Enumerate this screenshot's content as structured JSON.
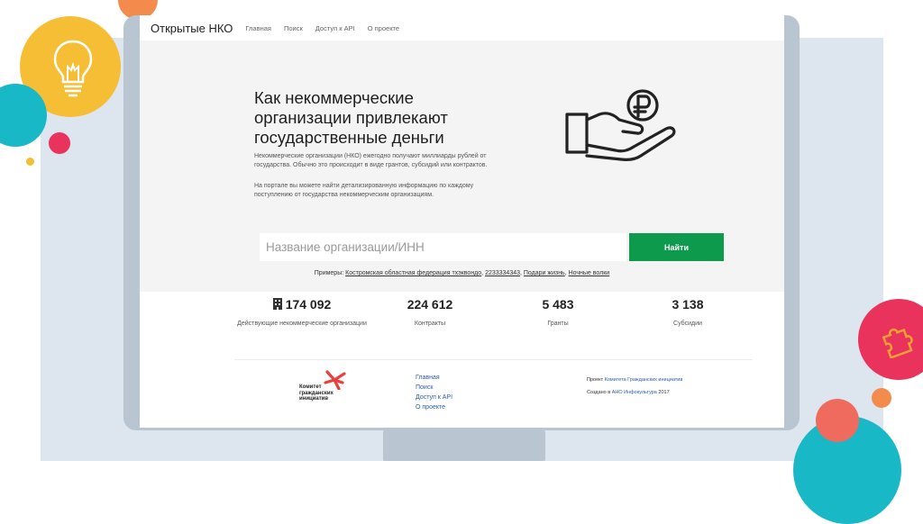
{
  "brand": "Открытые НКО",
  "nav": {
    "items": [
      {
        "label": "Главная"
      },
      {
        "label": "Поиск"
      },
      {
        "label": "Доступ к API"
      },
      {
        "label": "О проекте"
      }
    ]
  },
  "hero": {
    "title": "Как некоммерческие организации привлекают государственные деньги",
    "paragraph1": "Некоммерческие организации (НКО) ежегодно получают миллиарды рублей от государства. Обычно это происходит в виде грантов, субсидий или контрактов.",
    "paragraph2": "На портале вы можете найти детализированную информацию по каждому поступлению от государства некоммерческим организациям."
  },
  "search": {
    "placeholder": "Название организации/ИНН",
    "value": "",
    "button_label": "Найти"
  },
  "examples": {
    "prefix": "Примеры:",
    "items": [
      {
        "label": "Костромская областная федерация тхэквондо"
      },
      {
        "label": "2233334343"
      },
      {
        "label": "Подари жизнь"
      },
      {
        "label": "Ночные волки"
      }
    ]
  },
  "stats": [
    {
      "value": "174 092",
      "label": "Действующие некоммерческие организации",
      "icon": "building-icon"
    },
    {
      "value": "224 612",
      "label": "Контракты"
    },
    {
      "value": "5 483",
      "label": "Гранты"
    },
    {
      "value": "3 138",
      "label": "Субсидии"
    }
  ],
  "footer": {
    "logo_text": "Комитет гражданских инициатив",
    "links": [
      {
        "label": "Главная"
      },
      {
        "label": "Поиск"
      },
      {
        "label": "Доступ к API"
      },
      {
        "label": "О проекте"
      }
    ],
    "project_prefix": "Проект",
    "project_link": "Комитета Гражданских инициатив",
    "created_prefix": "Создано в",
    "created_link": "АНО Инфокультура",
    "created_year": "2017"
  },
  "colors": {
    "accent_green": "#0e9a4c",
    "link_blue": "#2a5db0",
    "logo_red": "#e8403f",
    "hero_background": "#f4f4f4"
  },
  "decorations": {
    "lightbulb_icon": "lightbulb-icon",
    "puzzle_icon": "puzzle-icon",
    "hero_icon": "hand-with-ruble-coin-icon"
  }
}
